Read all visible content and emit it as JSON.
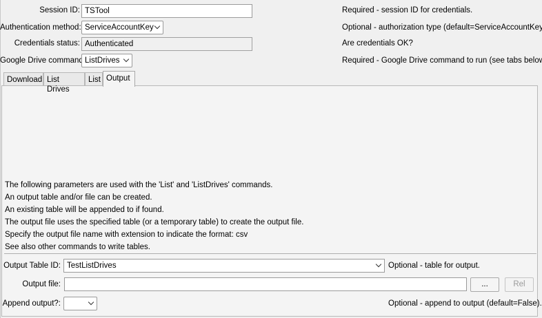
{
  "session": {
    "label": "Session ID:",
    "value": "TSTool",
    "note": "Required - session ID for credentials."
  },
  "auth": {
    "label": "Authentication method:",
    "value": "ServiceAccountKey",
    "note": "Optional - authorization type (default=ServiceAccountKey)."
  },
  "credentials": {
    "label": "Credentials status:",
    "value": "Authenticated",
    "note": "Are credentials OK?"
  },
  "command": {
    "label": "Google Drive command:",
    "value": "ListDrives",
    "note": "Required - Google Drive command to run (see tabs below)."
  },
  "tabs": [
    "Download",
    "List Drives",
    "List",
    "Output"
  ],
  "active_tab": "Output",
  "info_lines": [
    "The following parameters are used with the 'List' and 'ListDrives' commands.",
    "An output table and/or file can be created.",
    "An existing table will be appended to if found.",
    "The output file uses the specified table (or a temporary table) to create the output file.",
    "Specify the output file name with extension to indicate the format: csv",
    "See also other commands to write tables."
  ],
  "output_table": {
    "label": "Output Table ID:",
    "value": "TestListDrives",
    "note": "Optional - table for output."
  },
  "output_file": {
    "label": "Output file:",
    "value": "",
    "browse_label": "...",
    "rel_label": "Rel"
  },
  "append": {
    "label": "Append output?:",
    "value": "",
    "note": "Optional - append to output (default=False)."
  }
}
